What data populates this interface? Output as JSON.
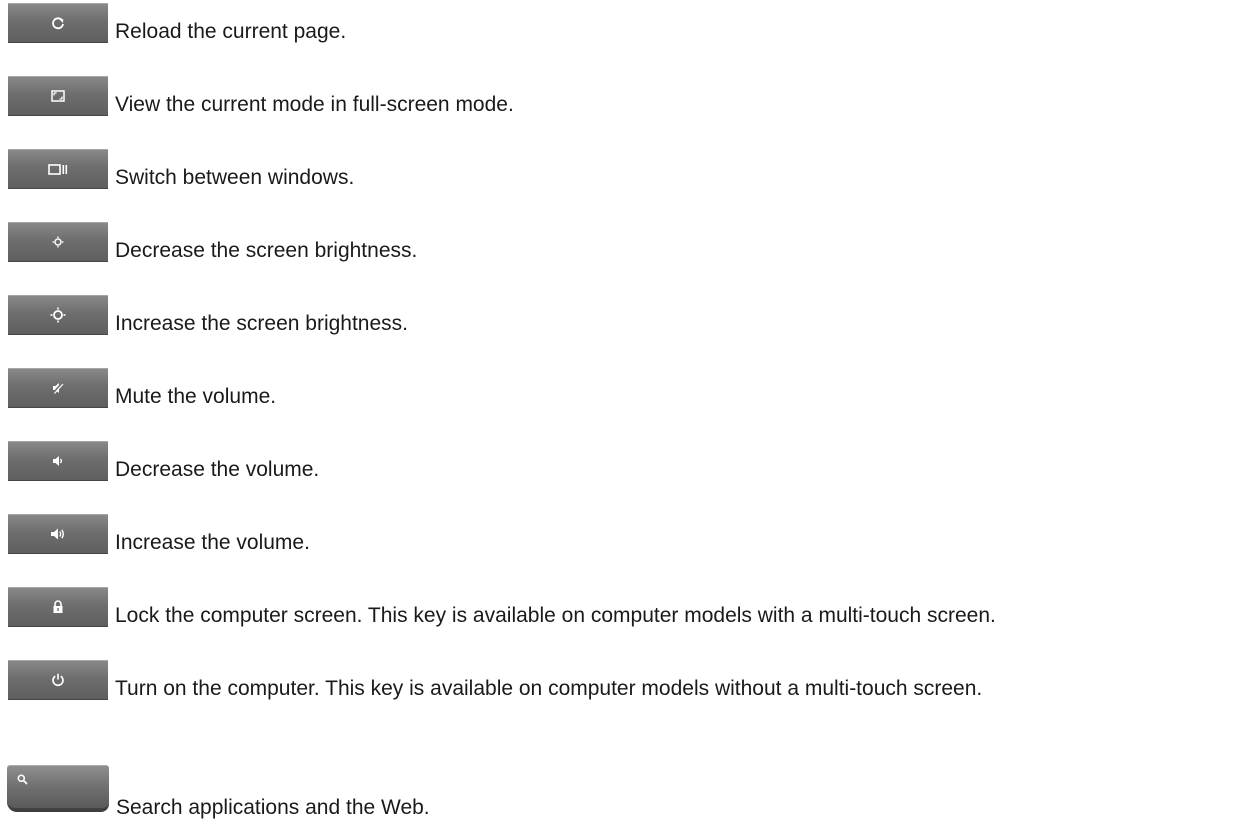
{
  "items": [
    {
      "icon": "reload-icon",
      "description": "Reload the current page."
    },
    {
      "icon": "fullscreen-icon",
      "description": "View the current mode in full-screen mode."
    },
    {
      "icon": "switch-windows-icon",
      "description": "Switch between windows."
    },
    {
      "icon": "brightness-down-icon",
      "description": "Decrease the screen brightness."
    },
    {
      "icon": "brightness-up-icon",
      "description": "Increase the screen brightness."
    },
    {
      "icon": "mute-icon",
      "description": "Mute the volume."
    },
    {
      "icon": "volume-down-icon",
      "description": "Decrease the volume."
    },
    {
      "icon": "volume-up-icon",
      "description": "Increase the volume."
    },
    {
      "icon": "lock-icon",
      "description": "Lock the computer screen. This key is available on computer models with a multi-touch screen."
    },
    {
      "icon": "power-icon",
      "description": "Turn on the computer. This key is available on computer models without a multi-touch screen."
    },
    {
      "icon": "search-icon",
      "description": "Search applications and the Web."
    }
  ],
  "colors": {
    "key_top": "#8a8a8a",
    "key_bottom": "#5e5e5e",
    "glyph": "#ffffff",
    "text": "#1a1a1a"
  }
}
